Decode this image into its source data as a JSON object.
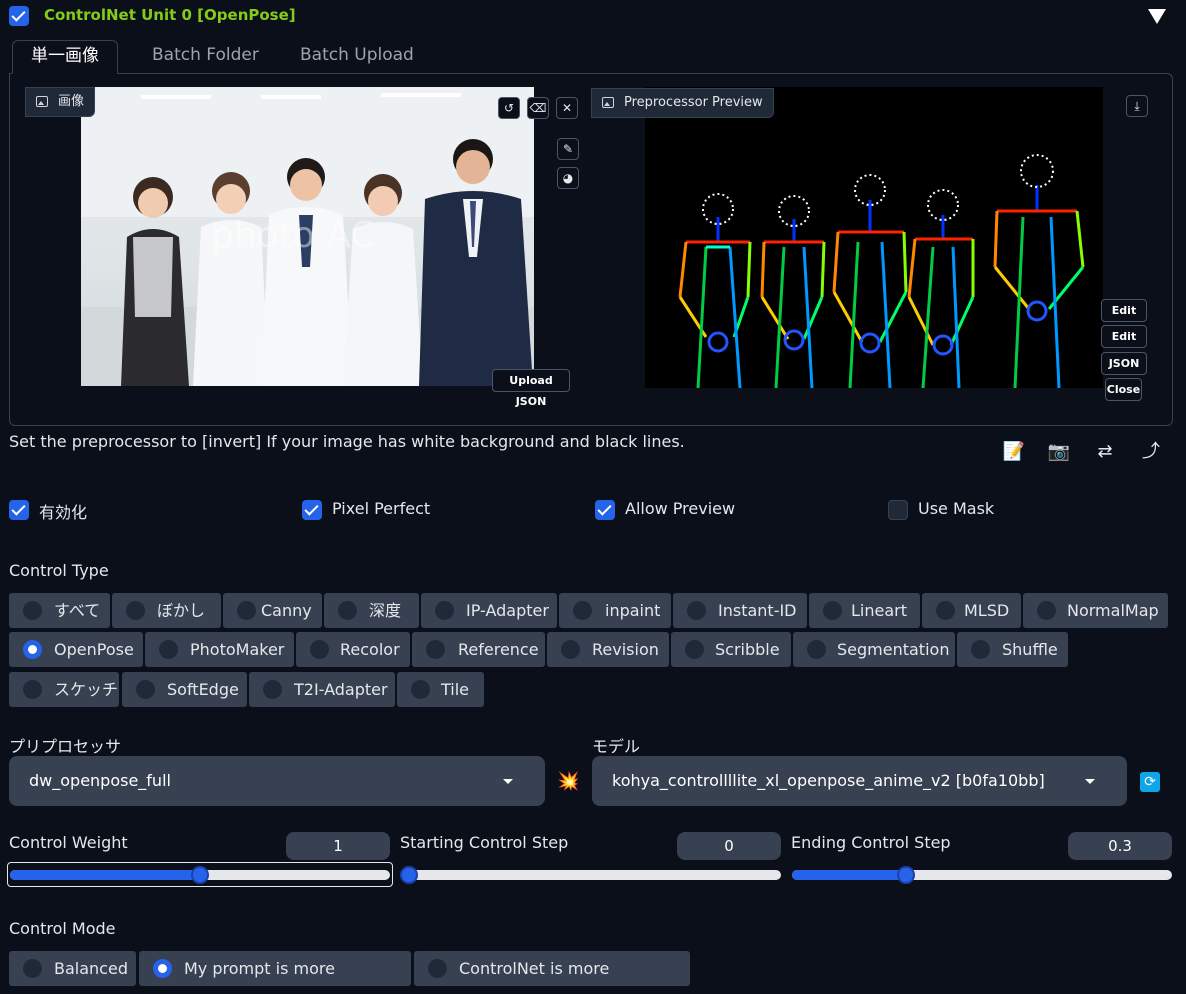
{
  "header": {
    "title": "ControlNet Unit 0  [OpenPose]",
    "enabled": true
  },
  "tabs": [
    "単一画像",
    "Batch Folder",
    "Batch Upload"
  ],
  "image_panel": {
    "input_label": "画像",
    "upload_json": "Upload JSON",
    "watermark": "photo AC",
    "preview_label": "Preprocessor Preview",
    "edit_photopea": "Edit",
    "edit": "Edit",
    "json": "JSON",
    "close": "Close"
  },
  "hint": "Set the preprocessor to [invert] If your image has white background and black lines.",
  "checkboxes": [
    {
      "label": "有効化",
      "checked": true
    },
    {
      "label": "Pixel Perfect",
      "checked": true
    },
    {
      "label": "Allow Preview",
      "checked": true
    },
    {
      "label": "Use Mask",
      "checked": false
    }
  ],
  "control_type": {
    "label": "Control Type",
    "options": [
      "すべて",
      "ぼかし",
      "Canny",
      "深度",
      "IP-Adapter",
      "inpaint",
      "Instant-ID",
      "Lineart",
      "MLSD",
      "NormalMap",
      "OpenPose",
      "PhotoMaker",
      "Recolor",
      "Reference",
      "Revision",
      "Scribble",
      "Segmentation",
      "Shuffle",
      "スケッチ",
      "SoftEdge",
      "T2I-Adapter",
      "Tile"
    ],
    "selected": "OpenPose"
  },
  "preprocessor": {
    "label": "プリプロセッサ",
    "value": "dw_openpose_full"
  },
  "model": {
    "label": "モデル",
    "value": "kohya_controllllite_xl_openpose_anime_v2 [b0fa10bb]"
  },
  "sliders": [
    {
      "label": "Control Weight",
      "value": "1",
      "fraction": 0.5
    },
    {
      "label": "Starting Control Step",
      "value": "0",
      "fraction": 0.0
    },
    {
      "label": "Ending Control Step",
      "value": "0.3",
      "fraction": 0.3
    }
  ],
  "control_mode": {
    "label": "Control Mode",
    "options": [
      "Balanced",
      "My prompt is more important",
      "ControlNet is more important"
    ],
    "selected": "My prompt is more important"
  },
  "colors": {
    "accent": "#2563eb",
    "title": "#84cc16",
    "background": "#0b0f19",
    "button": "#374151"
  }
}
